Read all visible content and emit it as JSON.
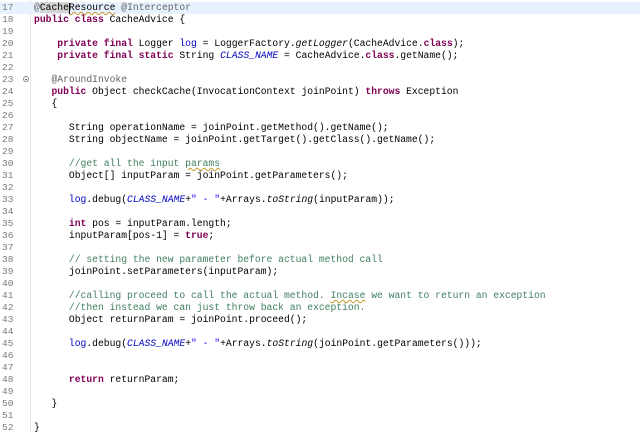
{
  "editor": {
    "caret_line": "17",
    "lines": [
      {
        "n": "17",
        "tokens": [
          [
            "ann",
            "@"
          ],
          [
            "sel",
            "Cache"
          ],
          [
            "sq",
            "Resource"
          ],
          [
            "txt",
            " "
          ],
          [
            "ann",
            "@Interceptor"
          ]
        ]
      },
      {
        "n": "18",
        "tokens": [
          [
            "kw",
            "public class"
          ],
          [
            "txt",
            " CacheAdvice {"
          ]
        ]
      },
      {
        "n": "19",
        "tokens": []
      },
      {
        "n": "20",
        "tokens": [
          [
            "txt",
            "    "
          ],
          [
            "kw",
            "private final"
          ],
          [
            "txt",
            " Logger "
          ],
          [
            "fld",
            "log"
          ],
          [
            "txt",
            " = LoggerFactory."
          ],
          [
            "smth",
            "getLogger"
          ],
          [
            "txt",
            "(CacheAdvice."
          ],
          [
            "kw",
            "class"
          ],
          [
            "txt",
            ");"
          ]
        ]
      },
      {
        "n": "21",
        "tokens": [
          [
            "txt",
            "    "
          ],
          [
            "kw",
            "private final static"
          ],
          [
            "txt",
            " String "
          ],
          [
            "sfld",
            "CLASS_NAME"
          ],
          [
            "txt",
            " = CacheAdvice."
          ],
          [
            "kw",
            "class"
          ],
          [
            "txt",
            ".getName();"
          ]
        ]
      },
      {
        "n": "22",
        "tokens": []
      },
      {
        "n": "23",
        "fold": true,
        "tokens": [
          [
            "txt",
            "   "
          ],
          [
            "ann",
            "@AroundInvoke"
          ]
        ]
      },
      {
        "n": "24",
        "tokens": [
          [
            "txt",
            "   "
          ],
          [
            "kw",
            "public"
          ],
          [
            "txt",
            " Object checkCache(InvocationContext joinPoint) "
          ],
          [
            "kw",
            "throws"
          ],
          [
            "txt",
            " Exception"
          ]
        ]
      },
      {
        "n": "25",
        "tokens": [
          [
            "txt",
            "   {"
          ]
        ]
      },
      {
        "n": "26",
        "tokens": []
      },
      {
        "n": "27",
        "tokens": [
          [
            "txt",
            "      String operationName = joinPoint.getMethod().getName();"
          ]
        ]
      },
      {
        "n": "28",
        "tokens": [
          [
            "txt",
            "      String objectName = joinPoint.getTarget().getClass().getName();"
          ]
        ]
      },
      {
        "n": "29",
        "tokens": []
      },
      {
        "n": "30",
        "tokens": [
          [
            "cmt",
            "      //get all the input "
          ],
          [
            "cmt sq",
            "params"
          ]
        ]
      },
      {
        "n": "31",
        "tokens": [
          [
            "txt",
            "      Object[] inputParam = joinPoint.getParameters();"
          ]
        ]
      },
      {
        "n": "32",
        "tokens": []
      },
      {
        "n": "33",
        "tokens": [
          [
            "txt",
            "      "
          ],
          [
            "fld",
            "log"
          ],
          [
            "txt",
            ".debug("
          ],
          [
            "sfld",
            "CLASS_NAME"
          ],
          [
            "txt",
            "+"
          ],
          [
            "str",
            "\" - \""
          ],
          [
            "txt",
            "+Arrays."
          ],
          [
            "smth",
            "toString"
          ],
          [
            "txt",
            "(inputParam));"
          ]
        ]
      },
      {
        "n": "34",
        "tokens": []
      },
      {
        "n": "35",
        "tokens": [
          [
            "txt",
            "      "
          ],
          [
            "kw",
            "int"
          ],
          [
            "txt",
            " pos = inputParam.length;"
          ]
        ]
      },
      {
        "n": "36",
        "tokens": [
          [
            "txt",
            "      inputParam[pos-1] = "
          ],
          [
            "kw",
            "true"
          ],
          [
            "txt",
            ";"
          ]
        ]
      },
      {
        "n": "37",
        "tokens": []
      },
      {
        "n": "38",
        "tokens": [
          [
            "cmt",
            "      // setting the new parameter before actual method call"
          ]
        ]
      },
      {
        "n": "39",
        "tokens": [
          [
            "txt",
            "      joinPoint.setParameters(inputParam);"
          ]
        ]
      },
      {
        "n": "40",
        "tokens": []
      },
      {
        "n": "41",
        "tokens": [
          [
            "cmt",
            "      //calling proceed to call the actual method. "
          ],
          [
            "cmt sq",
            "Incase"
          ],
          [
            "cmt",
            " we want to return an exception"
          ]
        ]
      },
      {
        "n": "42",
        "tokens": [
          [
            "cmt",
            "      //then instead we can just throw back an exception."
          ]
        ]
      },
      {
        "n": "43",
        "tokens": [
          [
            "txt",
            "      Object returnParam = joinPoint.proceed();"
          ]
        ]
      },
      {
        "n": "44",
        "tokens": []
      },
      {
        "n": "45",
        "tokens": [
          [
            "txt",
            "      "
          ],
          [
            "fld",
            "log"
          ],
          [
            "txt",
            ".debug("
          ],
          [
            "sfld",
            "CLASS_NAME"
          ],
          [
            "txt",
            "+"
          ],
          [
            "str",
            "\" - \""
          ],
          [
            "txt",
            "+Arrays."
          ],
          [
            "smth",
            "toString"
          ],
          [
            "txt",
            "(joinPoint.getParameters()));"
          ]
        ]
      },
      {
        "n": "46",
        "tokens": []
      },
      {
        "n": "47",
        "tokens": []
      },
      {
        "n": "48",
        "tokens": [
          [
            "txt",
            "      "
          ],
          [
            "kw",
            "return"
          ],
          [
            "txt",
            " returnParam;"
          ]
        ]
      },
      {
        "n": "49",
        "tokens": []
      },
      {
        "n": "50",
        "tokens": [
          [
            "txt",
            "   }"
          ]
        ]
      },
      {
        "n": "51",
        "tokens": []
      },
      {
        "n": "52",
        "tokens": [
          [
            "txt",
            "}"
          ]
        ]
      }
    ]
  }
}
